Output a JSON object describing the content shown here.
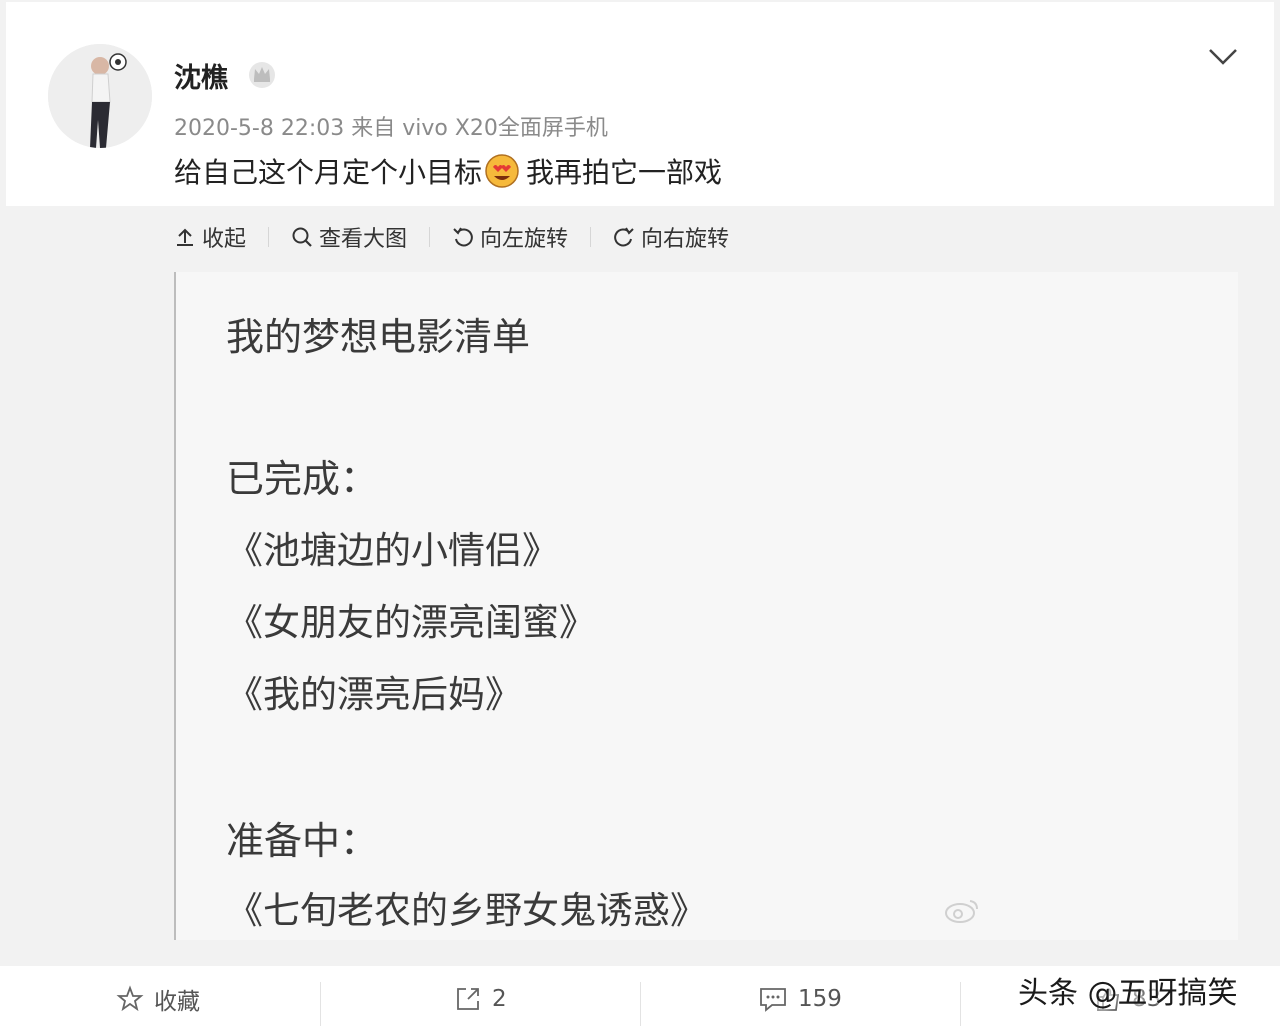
{
  "post": {
    "username": "沈樵",
    "meta": "2020-5-8 22:03 来自 vivo X20全面屏手机",
    "text_before": "给自己这个月定个小目标",
    "text_after": "我再拍它一部戏",
    "emoji": "heart-eyes-emoji-icon",
    "verified_icon": "crown-badge-icon",
    "more_icon": "chevron-down-icon"
  },
  "image_toolbar": {
    "collapse": "收起",
    "view_large": "查看大图",
    "rotate_left": "向左旋转",
    "rotate_right": "向右旋转"
  },
  "image_content": {
    "title": "我的梦想电影清单",
    "done_heading": "已完成：",
    "done_items": [
      "《池塘边的小情侣》",
      "《女朋友的漂亮闺蜜》",
      "《我的漂亮后妈》"
    ],
    "planned_heading": "准备中：",
    "planned_items": [
      "《七旬老农的乡野女鬼诱惑》"
    ]
  },
  "actions": {
    "favorite": "收藏",
    "repost_count": "2",
    "comment_count": "159",
    "like_count": "83"
  },
  "overlay_watermark": "头条 @五呀搞笑",
  "colors": {
    "background": "#f2f2f2",
    "card": "#ffffff",
    "muted_text": "#8a8a8a"
  }
}
